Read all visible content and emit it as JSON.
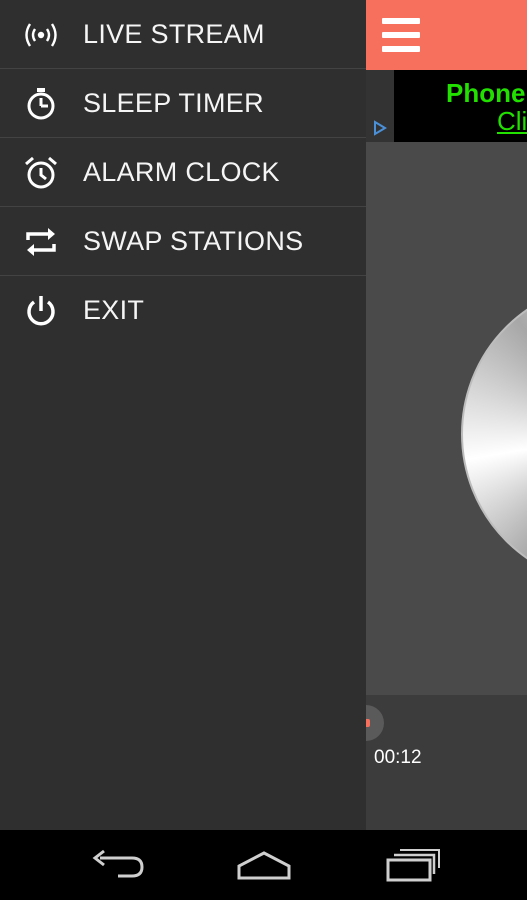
{
  "drawer": {
    "items": [
      {
        "label": "LIVE STREAM",
        "icon": "broadcast-icon"
      },
      {
        "label": "SLEEP TIMER",
        "icon": "stopwatch-icon"
      },
      {
        "label": "ALARM CLOCK",
        "icon": "alarm-clock-icon"
      },
      {
        "label": "SWAP STATIONS",
        "icon": "swap-icon"
      },
      {
        "label": "EXIT",
        "icon": "power-icon"
      }
    ]
  },
  "header": {
    "accent_color": "#f7705e",
    "menu_icon": "hamburger-menu-icon"
  },
  "ad": {
    "line1": "Phone",
    "line2": "Cli",
    "text_color": "#22e000"
  },
  "player": {
    "time": "00:12",
    "artwork": "cd-disc"
  },
  "navbar": {
    "buttons": [
      "back-icon",
      "home-icon",
      "recent-apps-icon"
    ]
  }
}
